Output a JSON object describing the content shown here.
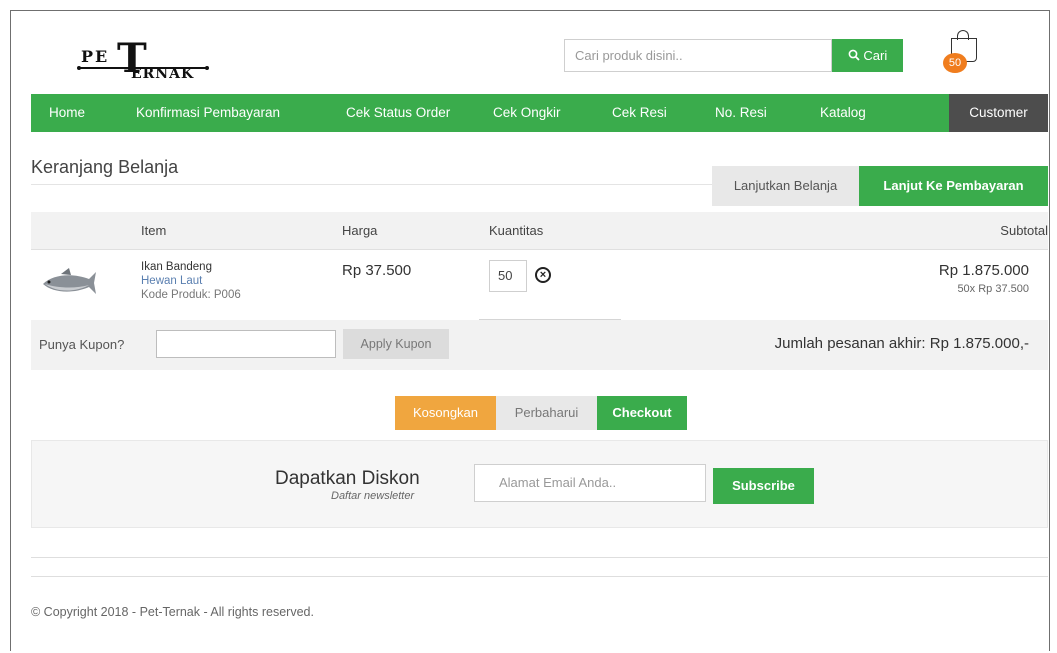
{
  "header": {
    "logo_line1": "PE",
    "logo_big_letter": "T",
    "logo_line2": "ERNAK",
    "search_placeholder": "Cari produk disini..",
    "search_button": "Cari",
    "cart_count": "50"
  },
  "nav": {
    "items": [
      "Home",
      "Konfirmasi Pembayaran",
      "Cek Status Order",
      "Cek Ongkir",
      "Cek Resi",
      "No. Resi",
      "Katalog"
    ],
    "customer": "Customer"
  },
  "cart": {
    "title": "Keranjang Belanja",
    "continue_button": "Lanjutkan Belanja",
    "checkout_top_button": "Lanjut Ke Pembayaran",
    "columns": [
      "Item",
      "Harga",
      "Kuantitas",
      "Subtotal"
    ],
    "rows": [
      {
        "name": "Ikan Bandeng",
        "category": "Hewan Laut",
        "code": "Kode Produk: P006",
        "price": "Rp 37.500",
        "quantity": "50",
        "subtotal": "Rp 1.875.000",
        "subtotal_note": "50x Rp 37.500"
      }
    ],
    "coupon_label": "Punya Kupon?",
    "coupon_value": "",
    "apply_button": "Apply Kupon",
    "total_text": "Jumlah pesanan akhir: Rp 1.875.000,-",
    "empty_button": "Kosongkan",
    "update_button": "Perbaharui",
    "checkout_button": "Checkout"
  },
  "newsletter": {
    "title": "Dapatkan Diskon",
    "subtitle": "Daftar newsletter",
    "email_placeholder": "Alamat Email Anda..",
    "subscribe_button": "Subscribe"
  },
  "footer": {
    "copyright": "© Copyright 2018 - Pet-Ternak - All rights reserved."
  },
  "colors": {
    "brand_green": "#3aac4c",
    "accent_orange": "#f0a63f",
    "badge_orange": "#f07d1e",
    "dark_nav": "#4d4d4d"
  }
}
